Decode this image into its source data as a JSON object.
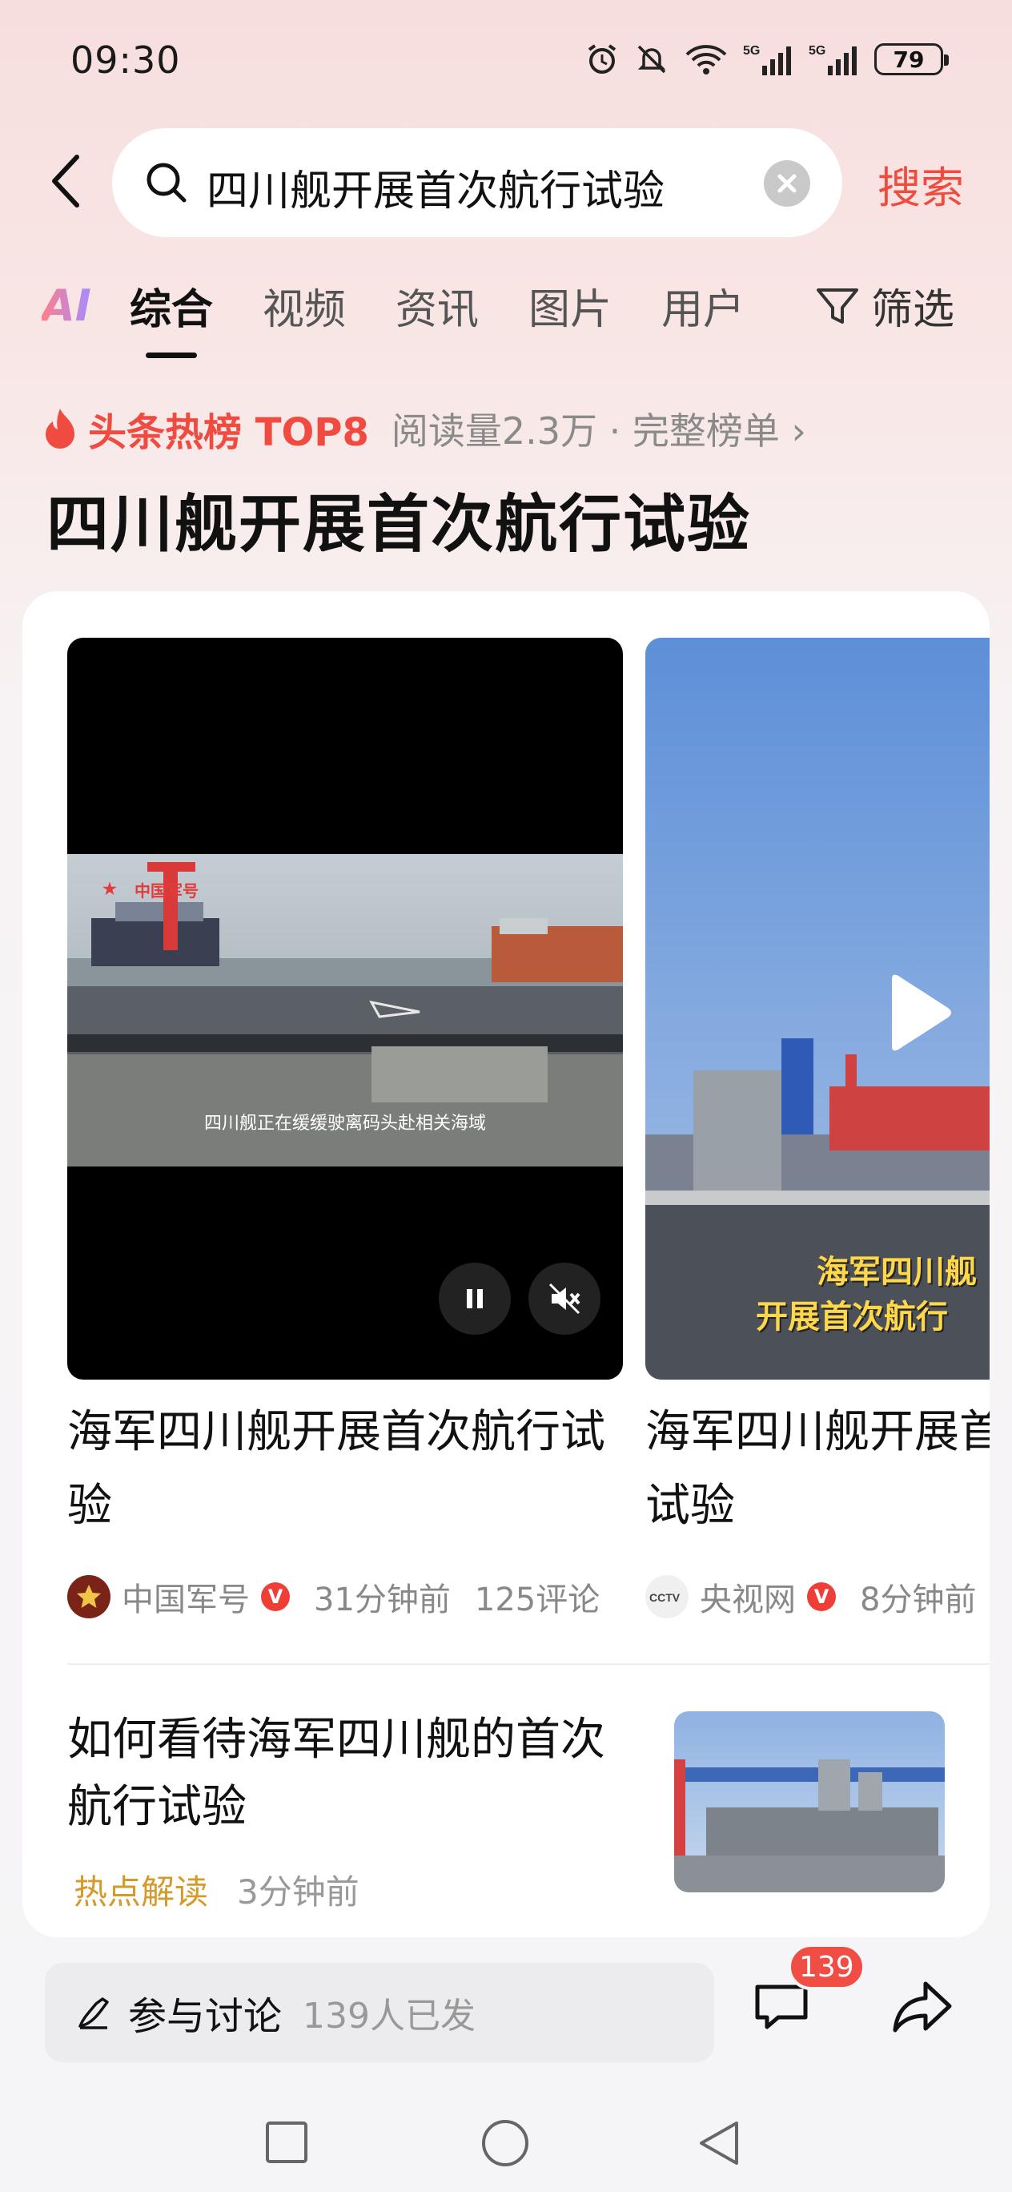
{
  "status_bar": {
    "time": "09:30",
    "battery": "79"
  },
  "search": {
    "query": "四川舰开展首次航行试验",
    "action_label": "搜索"
  },
  "tabs": [
    {
      "label": "AI"
    },
    {
      "label": "综合"
    },
    {
      "label": "视频"
    },
    {
      "label": "资讯"
    },
    {
      "label": "图片"
    },
    {
      "label": "用户"
    }
  ],
  "filter_label": "筛选",
  "hot": {
    "label": "头条热榜 TOP8",
    "meta": "阅读量2.3万 · 完整榜单 ›"
  },
  "page_title": "四川舰开展首次航行试验",
  "videos": [
    {
      "caption_logo": "中国军号",
      "subtitle": "四川舰正在缓缓驶离码头赴相关海域",
      "title": "海军四川舰开展首次航行试验",
      "source": "中国军号",
      "time": "31分钟前",
      "comments": "125评论"
    },
    {
      "overlay_line1": "海军四川舰",
      "overlay_line2": "开展首次航行",
      "title": "海军四川舰开展首次航行试验",
      "source": "央视网",
      "time": "8分钟前"
    }
  ],
  "article": {
    "title": "如何看待海军四川舰的首次航行试验",
    "tag": "热点解读",
    "time": "3分钟前"
  },
  "bottom": {
    "discuss_label": "参与讨论",
    "discuss_count": "139人已发",
    "comment_badge": "139"
  },
  "colors": {
    "accent": "#ef4b3f",
    "tag": "#d49a2a"
  }
}
